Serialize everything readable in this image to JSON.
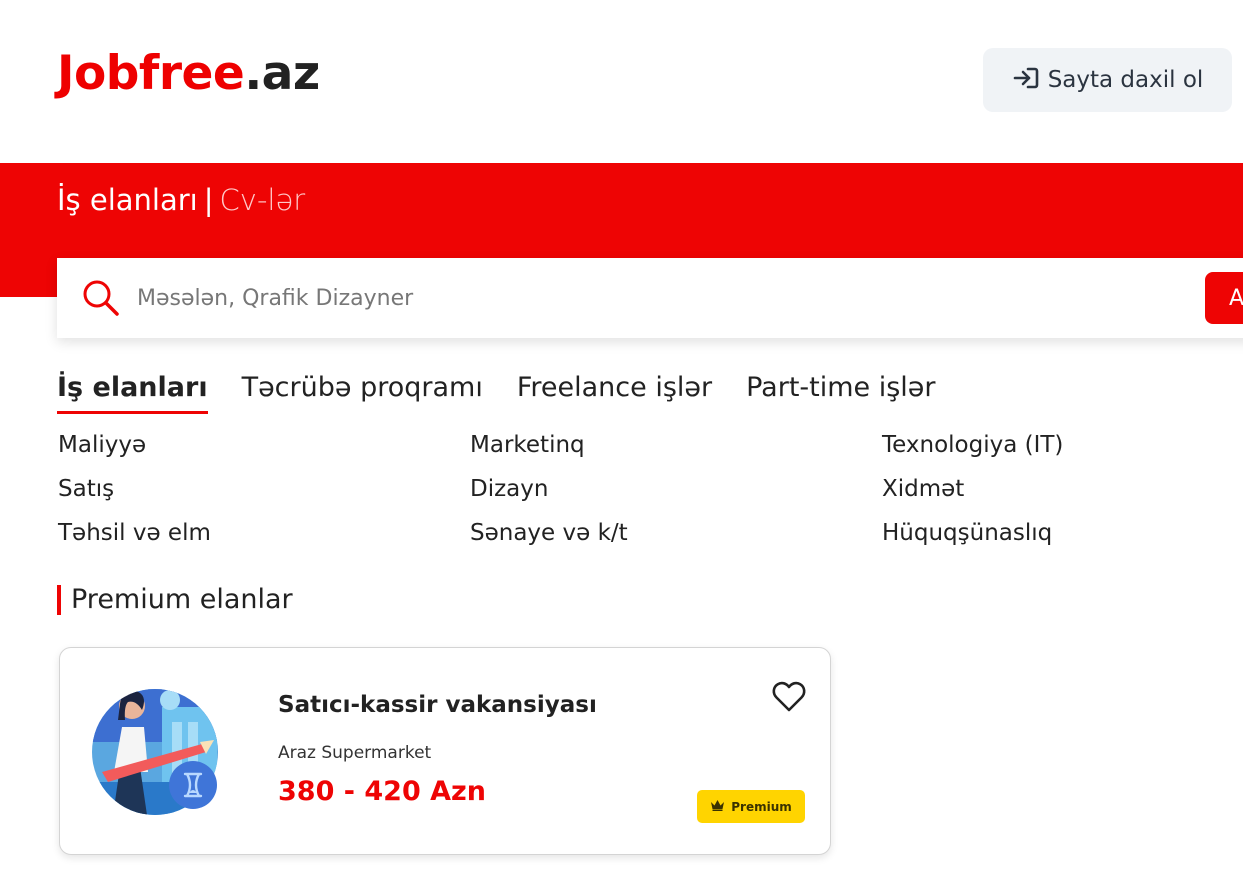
{
  "header": {
    "logo_brand": "Jobfree",
    "logo_tld": ".az",
    "login_label": "Sayta daxil ol"
  },
  "banner": {
    "tab_active": "İş elanları",
    "separator": "|",
    "tab_inactive": "Cv-lər"
  },
  "search": {
    "placeholder": "Məsələn, Qrafik Dizayner",
    "button_label": "A"
  },
  "tabs": [
    "İş elanları",
    "Təcrübə proqramı",
    "Freelance işlər",
    "Part-time işlər"
  ],
  "categories": [
    "Maliyyə",
    "Marketinq",
    "Texnologiya (IT)",
    "Satış",
    "Dizayn",
    "Xidmət",
    "Təhsil və elm",
    "Sənaye və k/t",
    "Hüquqşünaslıq"
  ],
  "premium_section": {
    "title": "Premium elanlar"
  },
  "job_card": {
    "title": "Satıcı-kassir vakansiyası",
    "company": "Araz Supermarket",
    "salary": "380 - 420 Azn",
    "badge": "Premium"
  },
  "colors": {
    "accent": "#ee0404",
    "badge": "#ffd400",
    "button_bg": "#f0f3f6"
  },
  "icons": {
    "login": "login-arrow-icon",
    "search": "search-icon",
    "favorite": "heart-icon",
    "badge": "crown-icon"
  }
}
